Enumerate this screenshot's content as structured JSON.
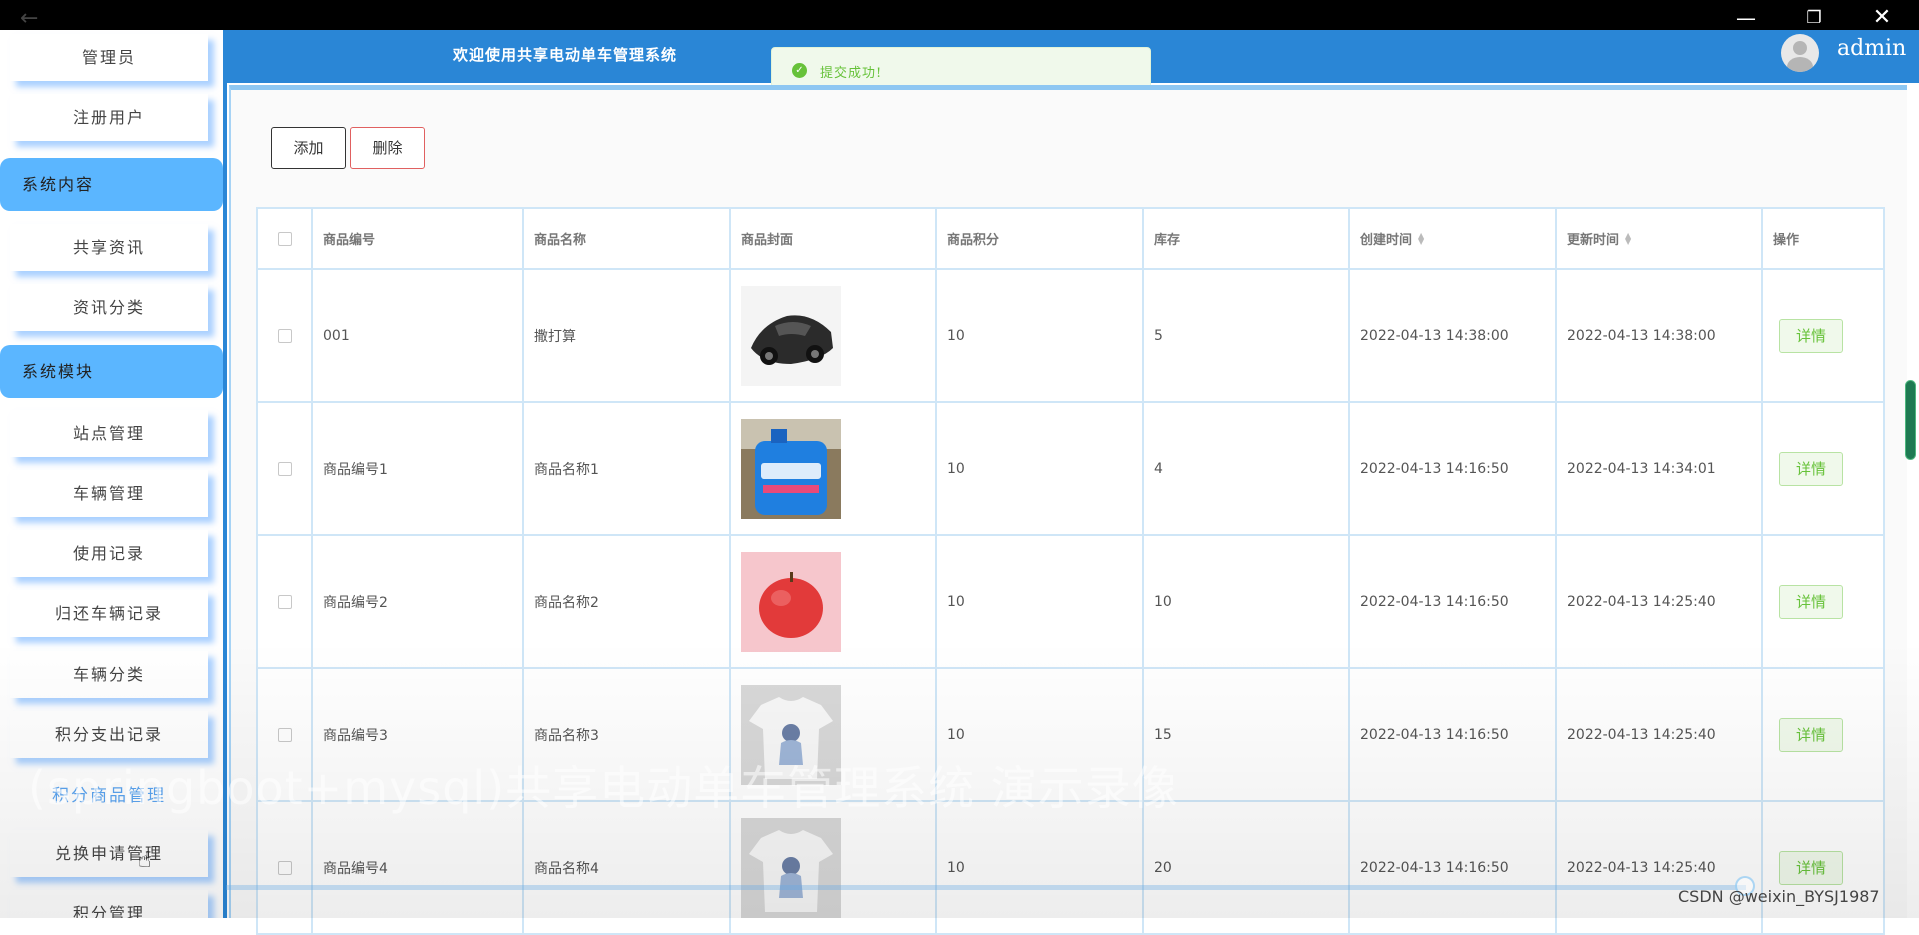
{
  "header": {
    "title": "欢迎使用共享电动单车管理系统",
    "username": "admin"
  },
  "toast": {
    "message": "提交成功!"
  },
  "sidebar": {
    "items": [
      "管理员",
      "注册用户"
    ],
    "groups": [
      {
        "label": "系统内容",
        "items": [
          "共享资讯",
          "资讯分类"
        ]
      },
      {
        "label": "系统模块",
        "items": [
          "站点管理",
          "车辆管理",
          "使用记录",
          "归还车辆记录",
          "车辆分类",
          "积分支出记录"
        ]
      }
    ],
    "active_item": "积分商品管理",
    "more_items": [
      "兑换申请管理",
      "积分管理"
    ]
  },
  "toolbar": {
    "add_label": "添加",
    "delete_label": "删除"
  },
  "table": {
    "columns": [
      "商品编号",
      "商品名称",
      "商品封面",
      "商品积分",
      "库存",
      "创建时间",
      "更新时间",
      "操作"
    ],
    "detail_label": "详情",
    "rows": [
      {
        "id": "001",
        "name": "撒打算",
        "cover": "car",
        "points": "10",
        "stock": "5",
        "created": "2022-04-13 14:38:00",
        "updated": "2022-04-13 14:38:00"
      },
      {
        "id": "商品编号1",
        "name": "商品名称1",
        "cover": "detergent",
        "points": "10",
        "stock": "4",
        "created": "2022-04-13 14:16:50",
        "updated": "2022-04-13 14:34:01"
      },
      {
        "id": "商品编号2",
        "name": "商品名称2",
        "cover": "apple",
        "points": "10",
        "stock": "10",
        "created": "2022-04-13 14:16:50",
        "updated": "2022-04-13 14:25:40"
      },
      {
        "id": "商品编号3",
        "name": "商品名称3",
        "cover": "tshirt",
        "points": "10",
        "stock": "15",
        "created": "2022-04-13 14:16:50",
        "updated": "2022-04-13 14:25:40"
      },
      {
        "id": "商品编号4",
        "name": "商品名称4",
        "cover": "tshirt",
        "points": "10",
        "stock": "20",
        "created": "2022-04-13 14:16:50",
        "updated": "2022-04-13 14:25:40"
      }
    ]
  },
  "overlay": {
    "watermark": "(springboot+mysql)共享电动单车管理系统 演示录像",
    "credit": "CSDN @weixin_BYSJ1987"
  },
  "colors": {
    "header": "#2a86d6",
    "menu_group": "#5bb6ff",
    "success": "#67c23a"
  }
}
